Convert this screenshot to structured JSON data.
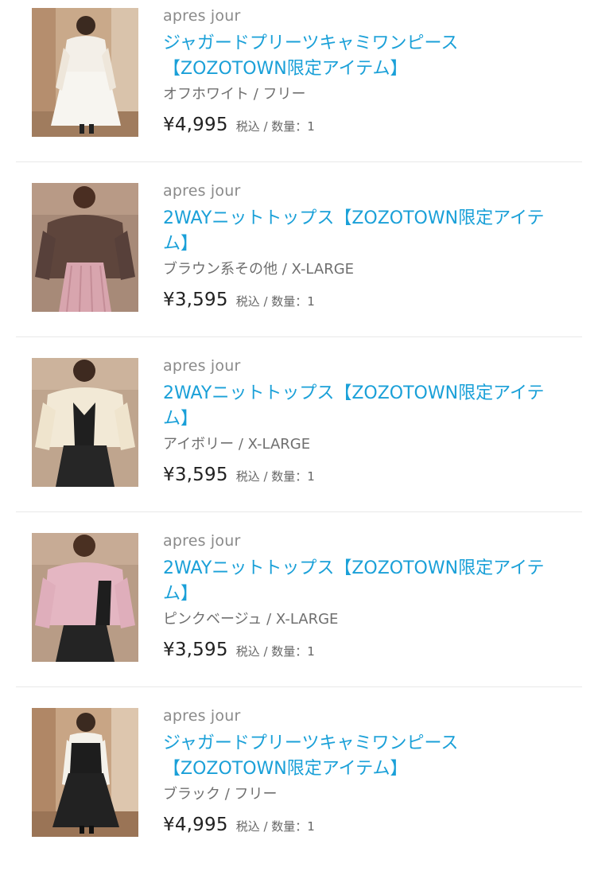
{
  "items": [
    {
      "brand": "apres jour",
      "title": "ジャガードプリーツキャミワンピース【ZOZOTOWN限定アイテム】",
      "variant": "オフホワイト / フリー",
      "price": "¥4,995",
      "tax_qty": "税込 / 数量：1"
    },
    {
      "brand": "apres jour",
      "title": "2WAYニットトップス【ZOZOTOWN限定アイテム】",
      "variant": "ブラウン系その他 / X-LARGE",
      "price": "¥3,595",
      "tax_qty": "税込 / 数量：1"
    },
    {
      "brand": "apres jour",
      "title": "2WAYニットトップス【ZOZOTOWN限定アイテム】",
      "variant": "アイボリー / X-LARGE",
      "price": "¥3,595",
      "tax_qty": "税込 / 数量：1"
    },
    {
      "brand": "apres jour",
      "title": "2WAYニットトップス【ZOZOTOWN限定アイテム】",
      "variant": "ピンクベージュ / X-LARGE",
      "price": "¥3,595",
      "tax_qty": "税込 / 数量：1"
    },
    {
      "brand": "apres jour",
      "title": "ジャガードプリーツキャミワンピース【ZOZOTOWN限定アイテム】",
      "variant": "ブラック / フリー",
      "price": "¥4,995",
      "tax_qty": "税込 / 数量：1"
    }
  ],
  "colors": {
    "link": "#1aa0d8",
    "brand": "#8a8a8a",
    "divider": "#e9e9e9"
  }
}
